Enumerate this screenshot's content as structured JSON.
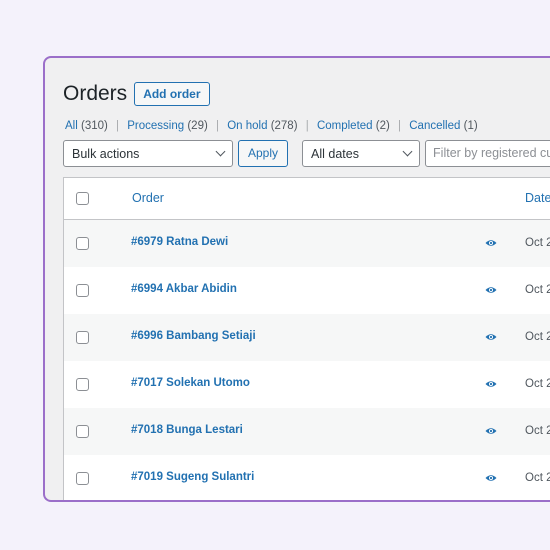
{
  "header": {
    "title": "Orders",
    "add_button": "Add order"
  },
  "status_filters": [
    {
      "label": "All",
      "count": "(310)"
    },
    {
      "label": "Processing",
      "count": "(29)"
    },
    {
      "label": "On hold",
      "count": "(278)"
    },
    {
      "label": "Completed",
      "count": "(2)"
    },
    {
      "label": "Cancelled",
      "count": "(1)"
    }
  ],
  "separator": "|",
  "toolbar": {
    "bulk_actions": "Bulk actions",
    "apply": "Apply",
    "dates": "All dates",
    "filter_placeholder": "Filter by registered customer"
  },
  "table": {
    "columns": {
      "order": "Order",
      "date": "Date"
    },
    "rows": [
      {
        "order": "#6979 Ratna Dewi",
        "date": "Oct 2"
      },
      {
        "order": "#6994 Akbar Abidin",
        "date": "Oct 2"
      },
      {
        "order": "#6996 Bambang Setiaji",
        "date": "Oct 2"
      },
      {
        "order": "#7017 Solekan Utomo",
        "date": "Oct 2"
      },
      {
        "order": "#7018 Bunga Lestari",
        "date": "Oct 2"
      },
      {
        "order": "#7019 Sugeng Sulantri",
        "date": "Oct 2"
      }
    ]
  },
  "colors": {
    "accent": "#2271b1",
    "frame_border": "#9b6fc9",
    "background": "#f4f2fb"
  },
  "icons": {
    "preview": "eye-icon",
    "dropdown": "chevron-down-icon"
  }
}
